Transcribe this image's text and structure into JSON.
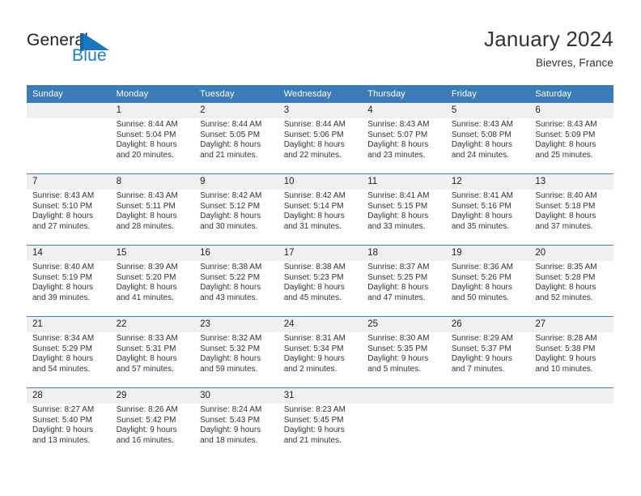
{
  "brand": {
    "name_part1": "General",
    "name_part2": "Blue",
    "logo_icon": "triangle-flag-icon"
  },
  "header": {
    "title": "January 2024",
    "subtitle": "Bievres, France"
  },
  "colors": {
    "header_blue": "#3b7cb8",
    "brand_blue": "#1f7fc4",
    "daynum_band": "#f0f0f0",
    "separator": "#4a7fad",
    "text": "#333333"
  },
  "calendar": {
    "weekday_headers": [
      "Sunday",
      "Monday",
      "Tuesday",
      "Wednesday",
      "Thursday",
      "Friday",
      "Saturday"
    ],
    "weeks": [
      {
        "daynums": [
          "",
          "1",
          "2",
          "3",
          "4",
          "5",
          "6"
        ],
        "cells": [
          {
            "lines": []
          },
          {
            "lines": [
              "Sunrise: 8:44 AM",
              "Sunset: 5:04 PM",
              "Daylight: 8 hours",
              "and 20 minutes."
            ]
          },
          {
            "lines": [
              "Sunrise: 8:44 AM",
              "Sunset: 5:05 PM",
              "Daylight: 8 hours",
              "and 21 minutes."
            ]
          },
          {
            "lines": [
              "Sunrise: 8:44 AM",
              "Sunset: 5:06 PM",
              "Daylight: 8 hours",
              "and 22 minutes."
            ]
          },
          {
            "lines": [
              "Sunrise: 8:43 AM",
              "Sunset: 5:07 PM",
              "Daylight: 8 hours",
              "and 23 minutes."
            ]
          },
          {
            "lines": [
              "Sunrise: 8:43 AM",
              "Sunset: 5:08 PM",
              "Daylight: 8 hours",
              "and 24 minutes."
            ]
          },
          {
            "lines": [
              "Sunrise: 8:43 AM",
              "Sunset: 5:09 PM",
              "Daylight: 8 hours",
              "and 25 minutes."
            ]
          }
        ]
      },
      {
        "daynums": [
          "7",
          "8",
          "9",
          "10",
          "11",
          "12",
          "13"
        ],
        "cells": [
          {
            "lines": [
              "Sunrise: 8:43 AM",
              "Sunset: 5:10 PM",
              "Daylight: 8 hours",
              "and 27 minutes."
            ]
          },
          {
            "lines": [
              "Sunrise: 8:43 AM",
              "Sunset: 5:11 PM",
              "Daylight: 8 hours",
              "and 28 minutes."
            ]
          },
          {
            "lines": [
              "Sunrise: 8:42 AM",
              "Sunset: 5:12 PM",
              "Daylight: 8 hours",
              "and 30 minutes."
            ]
          },
          {
            "lines": [
              "Sunrise: 8:42 AM",
              "Sunset: 5:14 PM",
              "Daylight: 8 hours",
              "and 31 minutes."
            ]
          },
          {
            "lines": [
              "Sunrise: 8:41 AM",
              "Sunset: 5:15 PM",
              "Daylight: 8 hours",
              "and 33 minutes."
            ]
          },
          {
            "lines": [
              "Sunrise: 8:41 AM",
              "Sunset: 5:16 PM",
              "Daylight: 8 hours",
              "and 35 minutes."
            ]
          },
          {
            "lines": [
              "Sunrise: 8:40 AM",
              "Sunset: 5:18 PM",
              "Daylight: 8 hours",
              "and 37 minutes."
            ]
          }
        ]
      },
      {
        "daynums": [
          "14",
          "15",
          "16",
          "17",
          "18",
          "19",
          "20"
        ],
        "cells": [
          {
            "lines": [
              "Sunrise: 8:40 AM",
              "Sunset: 5:19 PM",
              "Daylight: 8 hours",
              "and 39 minutes."
            ]
          },
          {
            "lines": [
              "Sunrise: 8:39 AM",
              "Sunset: 5:20 PM",
              "Daylight: 8 hours",
              "and 41 minutes."
            ]
          },
          {
            "lines": [
              "Sunrise: 8:38 AM",
              "Sunset: 5:22 PM",
              "Daylight: 8 hours",
              "and 43 minutes."
            ]
          },
          {
            "lines": [
              "Sunrise: 8:38 AM",
              "Sunset: 5:23 PM",
              "Daylight: 8 hours",
              "and 45 minutes."
            ]
          },
          {
            "lines": [
              "Sunrise: 8:37 AM",
              "Sunset: 5:25 PM",
              "Daylight: 8 hours",
              "and 47 minutes."
            ]
          },
          {
            "lines": [
              "Sunrise: 8:36 AM",
              "Sunset: 5:26 PM",
              "Daylight: 8 hours",
              "and 50 minutes."
            ]
          },
          {
            "lines": [
              "Sunrise: 8:35 AM",
              "Sunset: 5:28 PM",
              "Daylight: 8 hours",
              "and 52 minutes."
            ]
          }
        ]
      },
      {
        "daynums": [
          "21",
          "22",
          "23",
          "24",
          "25",
          "26",
          "27"
        ],
        "cells": [
          {
            "lines": [
              "Sunrise: 8:34 AM",
              "Sunset: 5:29 PM",
              "Daylight: 8 hours",
              "and 54 minutes."
            ]
          },
          {
            "lines": [
              "Sunrise: 8:33 AM",
              "Sunset: 5:31 PM",
              "Daylight: 8 hours",
              "and 57 minutes."
            ]
          },
          {
            "lines": [
              "Sunrise: 8:32 AM",
              "Sunset: 5:32 PM",
              "Daylight: 8 hours",
              "and 59 minutes."
            ]
          },
          {
            "lines": [
              "Sunrise: 8:31 AM",
              "Sunset: 5:34 PM",
              "Daylight: 9 hours",
              "and 2 minutes."
            ]
          },
          {
            "lines": [
              "Sunrise: 8:30 AM",
              "Sunset: 5:35 PM",
              "Daylight: 9 hours",
              "and 5 minutes."
            ]
          },
          {
            "lines": [
              "Sunrise: 8:29 AM",
              "Sunset: 5:37 PM",
              "Daylight: 9 hours",
              "and 7 minutes."
            ]
          },
          {
            "lines": [
              "Sunrise: 8:28 AM",
              "Sunset: 5:38 PM",
              "Daylight: 9 hours",
              "and 10 minutes."
            ]
          }
        ]
      },
      {
        "daynums": [
          "28",
          "29",
          "30",
          "31",
          "",
          "",
          ""
        ],
        "cells": [
          {
            "lines": [
              "Sunrise: 8:27 AM",
              "Sunset: 5:40 PM",
              "Daylight: 9 hours",
              "and 13 minutes."
            ]
          },
          {
            "lines": [
              "Sunrise: 8:26 AM",
              "Sunset: 5:42 PM",
              "Daylight: 9 hours",
              "and 16 minutes."
            ]
          },
          {
            "lines": [
              "Sunrise: 8:24 AM",
              "Sunset: 5:43 PM",
              "Daylight: 9 hours",
              "and 18 minutes."
            ]
          },
          {
            "lines": [
              "Sunrise: 8:23 AM",
              "Sunset: 5:45 PM",
              "Daylight: 9 hours",
              "and 21 minutes."
            ]
          },
          {
            "lines": []
          },
          {
            "lines": []
          },
          {
            "lines": []
          }
        ]
      }
    ]
  }
}
